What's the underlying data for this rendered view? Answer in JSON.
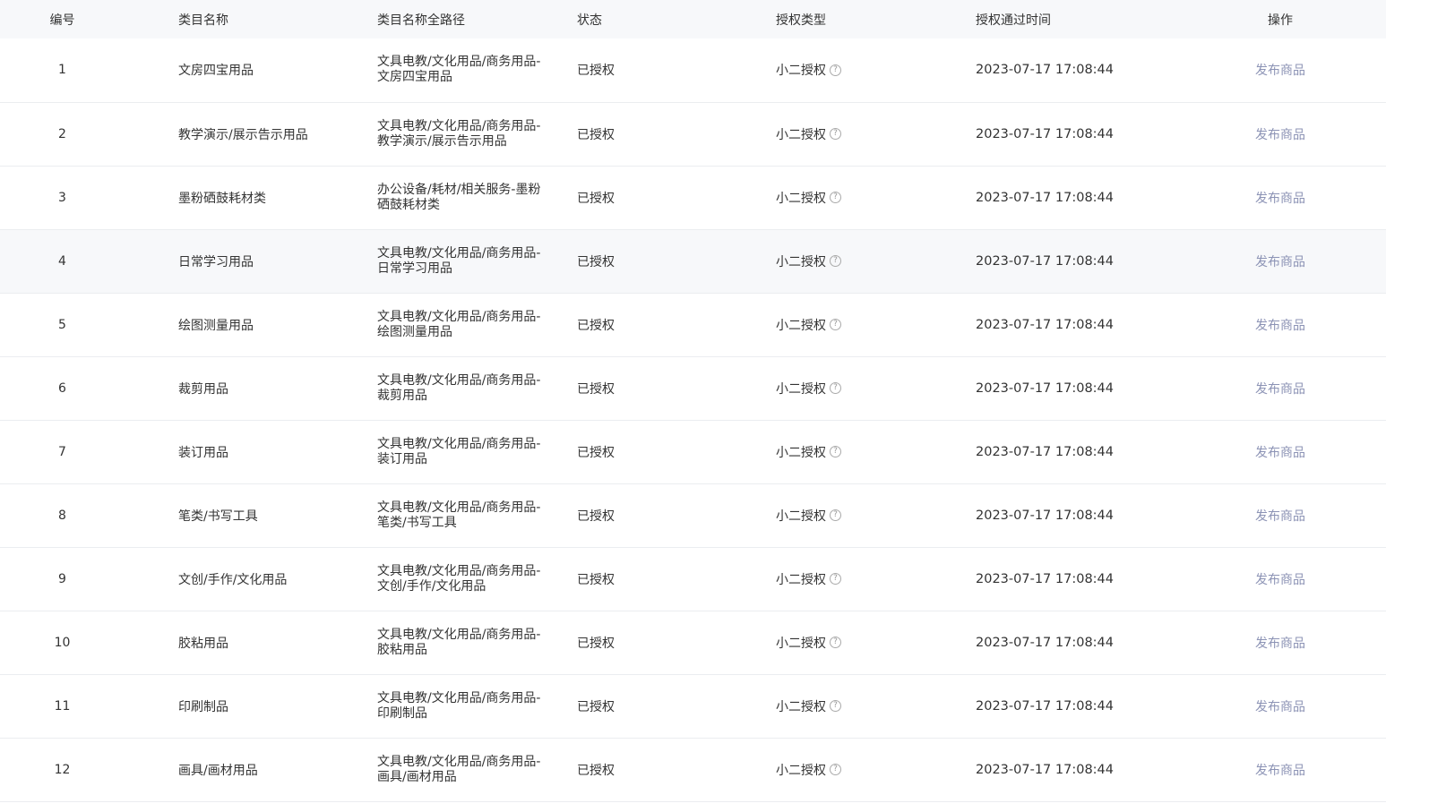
{
  "table": {
    "headers": {
      "no": "编号",
      "name": "类目名称",
      "path": "类目名称全路径",
      "status": "状态",
      "auth_type": "授权类型",
      "auth_time": "授权通过时间",
      "operation": "操作"
    },
    "rows": [
      {
        "no": "1",
        "name": "文房四宝用品",
        "path": "文具电教/文化用品/商务用品-文房四宝用品",
        "status": "已授权",
        "auth_type": "小二授权",
        "auth_time": "2023-07-17 17:08:44",
        "action": "发布商品"
      },
      {
        "no": "2",
        "name": "教学演示/展示告示用品",
        "path": "文具电教/文化用品/商务用品-教学演示/展示告示用品",
        "status": "已授权",
        "auth_type": "小二授权",
        "auth_time": "2023-07-17 17:08:44",
        "action": "发布商品"
      },
      {
        "no": "3",
        "name": "墨粉硒鼓耗材类",
        "path": "办公设备/耗材/相关服务-墨粉硒鼓耗材类",
        "status": "已授权",
        "auth_type": "小二授权",
        "auth_time": "2023-07-17 17:08:44",
        "action": "发布商品"
      },
      {
        "no": "4",
        "name": "日常学习用品",
        "path": "文具电教/文化用品/商务用品-日常学习用品",
        "status": "已授权",
        "auth_type": "小二授权",
        "auth_time": "2023-07-17 17:08:44",
        "action": "发布商品"
      },
      {
        "no": "5",
        "name": "绘图测量用品",
        "path": "文具电教/文化用品/商务用品-绘图测量用品",
        "status": "已授权",
        "auth_type": "小二授权",
        "auth_time": "2023-07-17 17:08:44",
        "action": "发布商品"
      },
      {
        "no": "6",
        "name": "裁剪用品",
        "path": "文具电教/文化用品/商务用品-裁剪用品",
        "status": "已授权",
        "auth_type": "小二授权",
        "auth_time": "2023-07-17 17:08:44",
        "action": "发布商品"
      },
      {
        "no": "7",
        "name": "装订用品",
        "path": "文具电教/文化用品/商务用品-装订用品",
        "status": "已授权",
        "auth_type": "小二授权",
        "auth_time": "2023-07-17 17:08:44",
        "action": "发布商品"
      },
      {
        "no": "8",
        "name": "笔类/书写工具",
        "path": "文具电教/文化用品/商务用品-笔类/书写工具",
        "status": "已授权",
        "auth_type": "小二授权",
        "auth_time": "2023-07-17 17:08:44",
        "action": "发布商品"
      },
      {
        "no": "9",
        "name": "文创/手作/文化用品",
        "path": "文具电教/文化用品/商务用品-文创/手作/文化用品",
        "status": "已授权",
        "auth_type": "小二授权",
        "auth_time": "2023-07-17 17:08:44",
        "action": "发布商品"
      },
      {
        "no": "10",
        "name": "胶粘用品",
        "path": "文具电教/文化用品/商务用品-胶粘用品",
        "status": "已授权",
        "auth_type": "小二授权",
        "auth_time": "2023-07-17 17:08:44",
        "action": "发布商品"
      },
      {
        "no": "11",
        "name": "印刷制品",
        "path": "文具电教/文化用品/商务用品-印刷制品",
        "status": "已授权",
        "auth_type": "小二授权",
        "auth_time": "2023-07-17 17:08:44",
        "action": "发布商品"
      },
      {
        "no": "12",
        "name": "画具/画材用品",
        "path": "文具电教/文化用品/商务用品-画具/画材用品",
        "status": "已授权",
        "auth_type": "小二授权",
        "auth_time": "2023-07-17 17:08:44",
        "action": "发布商品"
      }
    ]
  },
  "icons": {
    "help": "question-circle-icon"
  },
  "colors": {
    "header_bg": "#f7f8fa",
    "link": "#8c93b5",
    "row_border": "#ebedf0",
    "hover_row_bg": "#f7f8fa"
  }
}
